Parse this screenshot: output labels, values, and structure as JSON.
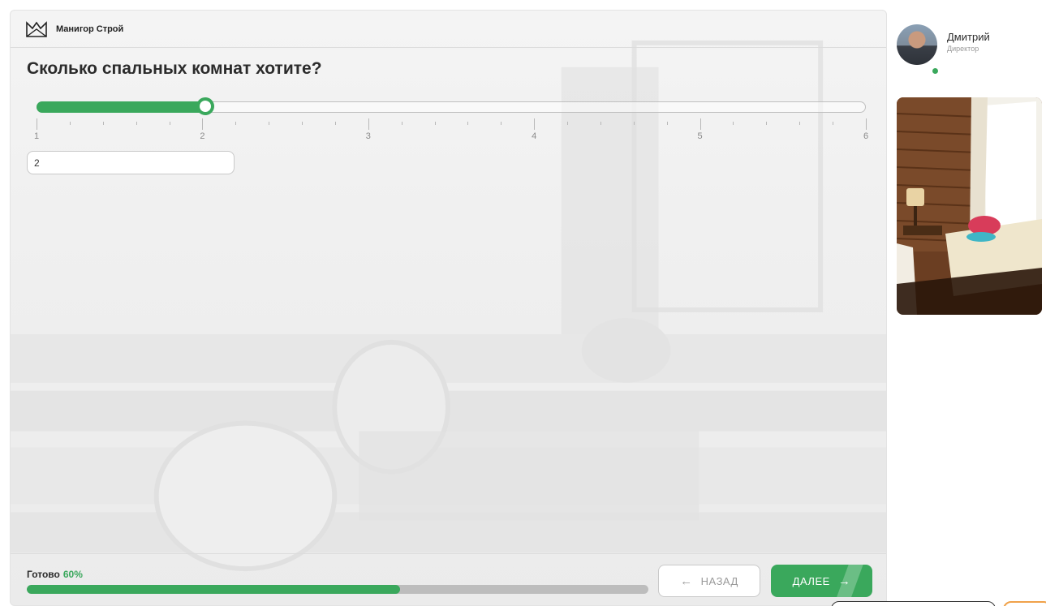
{
  "brand": {
    "name": "Манигор Строй"
  },
  "question": {
    "title": "Сколько спальных комнат хотите?"
  },
  "slider": {
    "min": 1,
    "max": 6,
    "value": 2,
    "labels": [
      "1",
      "2",
      "3",
      "4",
      "5",
      "6"
    ],
    "accent": "#3aa85c"
  },
  "answer_input": {
    "value": "2"
  },
  "progress": {
    "label": "Готово",
    "percent_text": "60%",
    "fraction": 0.6
  },
  "buttons": {
    "back_label": "НАЗАД",
    "next_label": "ДАЛЕЕ"
  },
  "manager": {
    "name": "Дмитрий",
    "role": "Директор",
    "status": "online"
  },
  "icons": {
    "logo": "crown-house-logo-icon",
    "back": "arrow-left-icon",
    "next": "arrow-right-icon"
  }
}
